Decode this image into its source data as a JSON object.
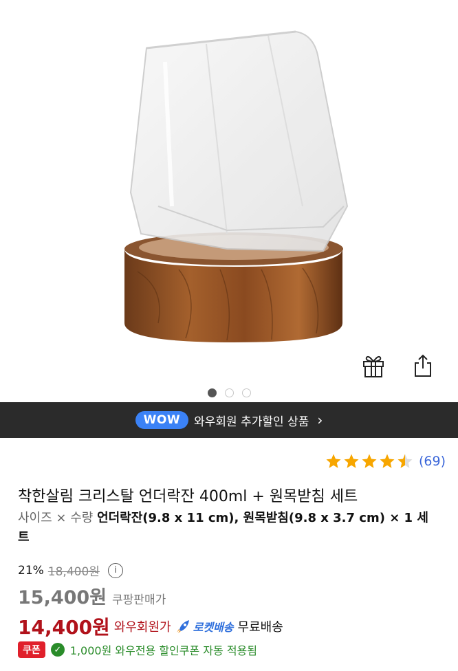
{
  "hero": {
    "image_alt": "crystal underlock glass on wooden base",
    "actions": {
      "gift_icon": "gift-icon",
      "share_icon": "share-icon"
    },
    "dots_active": 0,
    "dots_total": 3
  },
  "wow_bar": {
    "badge": "WOW",
    "text": "와우회원 추가할인 상품",
    "chevron": "›"
  },
  "rating": {
    "stars": 4.5,
    "count": "(69)",
    "star_color": "#f7a600"
  },
  "product": {
    "title": "착한살림 크리스탈 언더락잔 400ml + 원목받침 세트",
    "option_label": "사이즈 × 수량",
    "option_value": "언더락잔(9.8 x 11 cm), 원목받침(9.8 x 3.7 cm) × 1 세트"
  },
  "pricing": {
    "discount": "21%",
    "original": "18,400원",
    "info": "i",
    "sale_price": "15,400원",
    "sale_label": "쿠팡판매가",
    "wow_price": "14,400원",
    "wow_label": "와우회원가",
    "rocket": "로켓배송",
    "shipping": "무료배송"
  },
  "coupon": {
    "badge": "쿠폰",
    "text": "1,000원 와우전용 할인쿠폰 자동 적용됨"
  },
  "colors": {
    "accent_red": "#b1121b",
    "blue": "#3b82f6",
    "green": "#2a8c2a"
  }
}
